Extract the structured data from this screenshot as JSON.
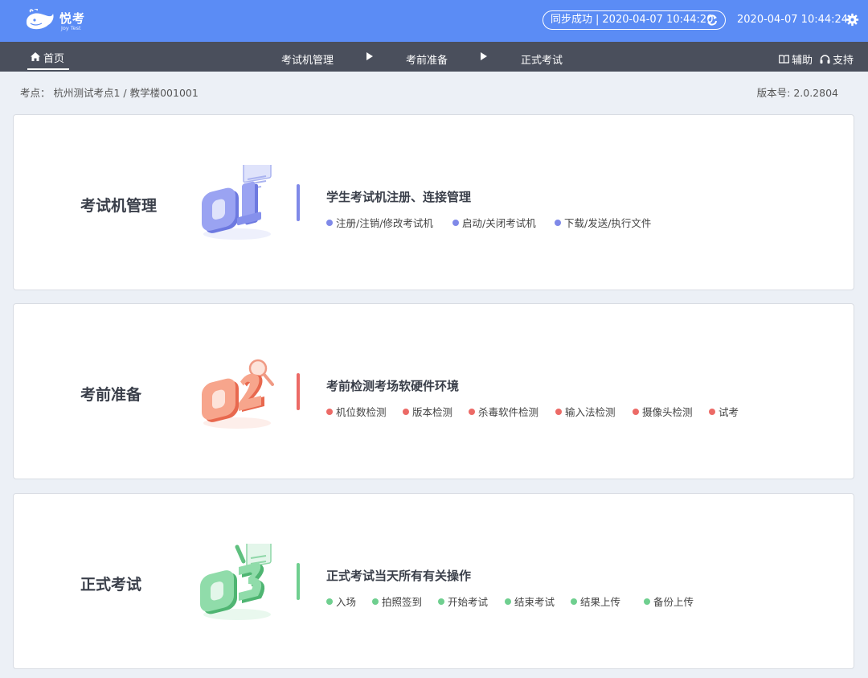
{
  "app": {
    "logo_title": "悦考",
    "logo_subtitle": "Joy Test"
  },
  "header": {
    "sync_status": "同步成功",
    "sync_time": "2020-04-07 10:44:20",
    "clock": "2020-04-07 10:44:24",
    "icons": [
      "refresh-icon",
      "gear-icon"
    ]
  },
  "nav": {
    "home": "首页",
    "steps": [
      "考试机管理",
      "考前准备",
      "正式考试"
    ],
    "help": "辅助",
    "support": "支持"
  },
  "info": {
    "site": "考点： 杭州测试考点1 / 教学楼001001",
    "version": "版本号: 2.0.2804"
  },
  "cards": [
    {
      "title": "考试机管理",
      "heading": "学生考试机注册、连接管理",
      "color": "#7f89e8",
      "items": [
        "注册/注销/修改考试机",
        "启动/关闭考试机",
        "下载/发送/执行文件"
      ]
    },
    {
      "title": "考前准备",
      "heading": "考前检测考场软硬件环境",
      "color": "#ec6a66",
      "items": [
        "机位数检测",
        "版本检测",
        "杀毒软件检测",
        "输入法检测",
        "摄像头检测",
        "试考"
      ]
    },
    {
      "title": "正式考试",
      "heading": "正式考试当天所有有关操作",
      "color": "#6fcf8f",
      "items": [
        "入场",
        "拍照签到",
        "开始考试",
        "结束考试",
        "结果上传",
        "备份上传"
      ]
    }
  ]
}
